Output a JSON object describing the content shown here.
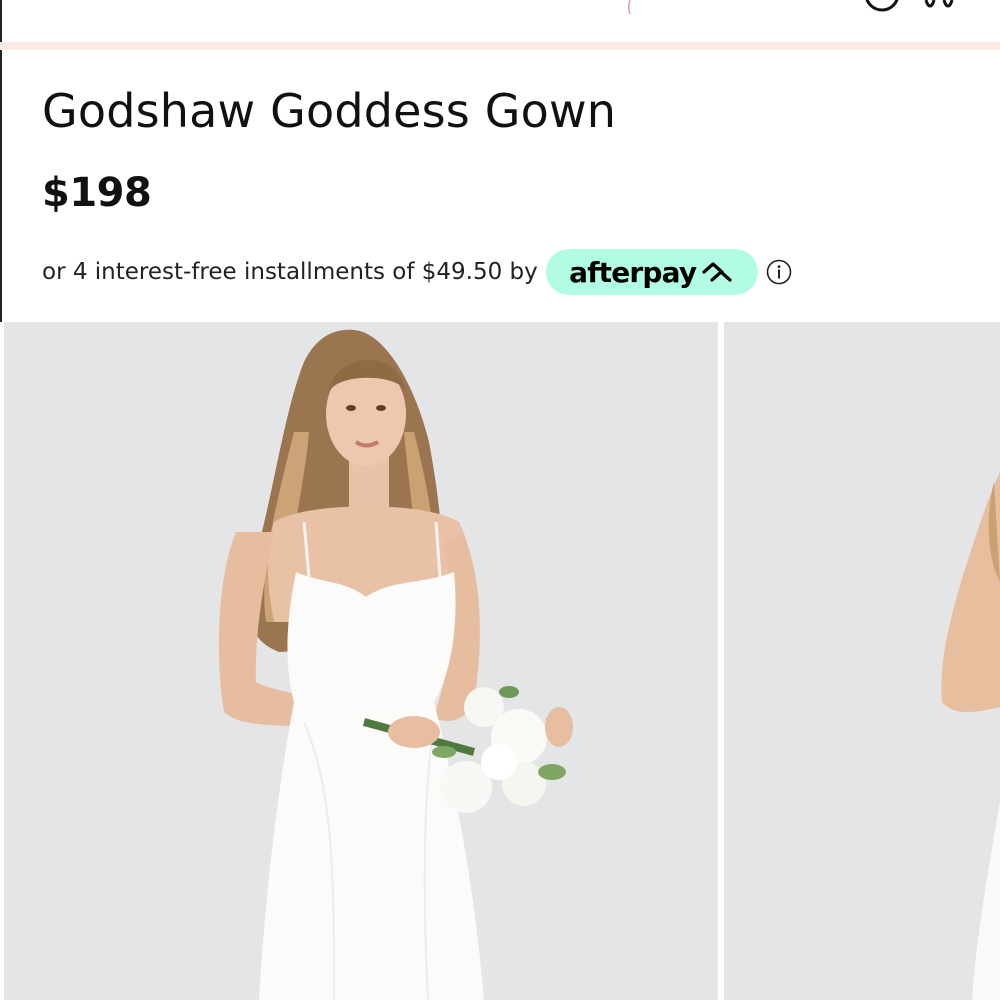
{
  "product": {
    "title": "Godshaw Goddess Gown",
    "price": "$198",
    "installment_text": "or 4 interest-free installments of $49.50 by"
  },
  "afterpay": {
    "label": "afterpay",
    "badge_color": "#b2fce4"
  },
  "icons": {
    "info": "info-icon",
    "afterpay_logo": "afterpay-arrows-icon"
  },
  "colors": {
    "accent_band": "#fbe9e6",
    "text": "#111111",
    "photo_background": "#e3e5e6"
  }
}
